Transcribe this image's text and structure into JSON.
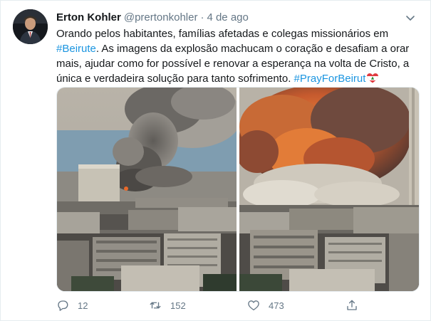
{
  "tweet": {
    "author_name": "Erton Kohler",
    "handle": "@prertonkohler",
    "separator": "·",
    "date": "4 de ago",
    "text": {
      "part1": "Orando pelos habitantes, famílias afetadas e colegas missionários em ",
      "hashtag1": "#Beirute",
      "part2": ". As imagens da explosão machucam o coração e desafiam a orar mais, ajudar como for possível e renovar a esperança na volta de Cristo, a única e verdadeira solução para tanto sofrimento. ",
      "hashtag2": "#PrayForBeirut"
    },
    "emoji": "lebanon-flag-heart",
    "media": [
      {
        "icon": "explosion-smoke-photo"
      },
      {
        "icon": "explosion-fireball-photo"
      }
    ]
  },
  "actions": {
    "reply_count": "12",
    "retweet_count": "152",
    "like_count": "473",
    "icons": [
      "reply-icon",
      "retweet-icon",
      "like-icon",
      "share-icon"
    ]
  },
  "colors": {
    "link": "#1b95e0",
    "muted": "#657786",
    "border": "#e6ecf0"
  }
}
